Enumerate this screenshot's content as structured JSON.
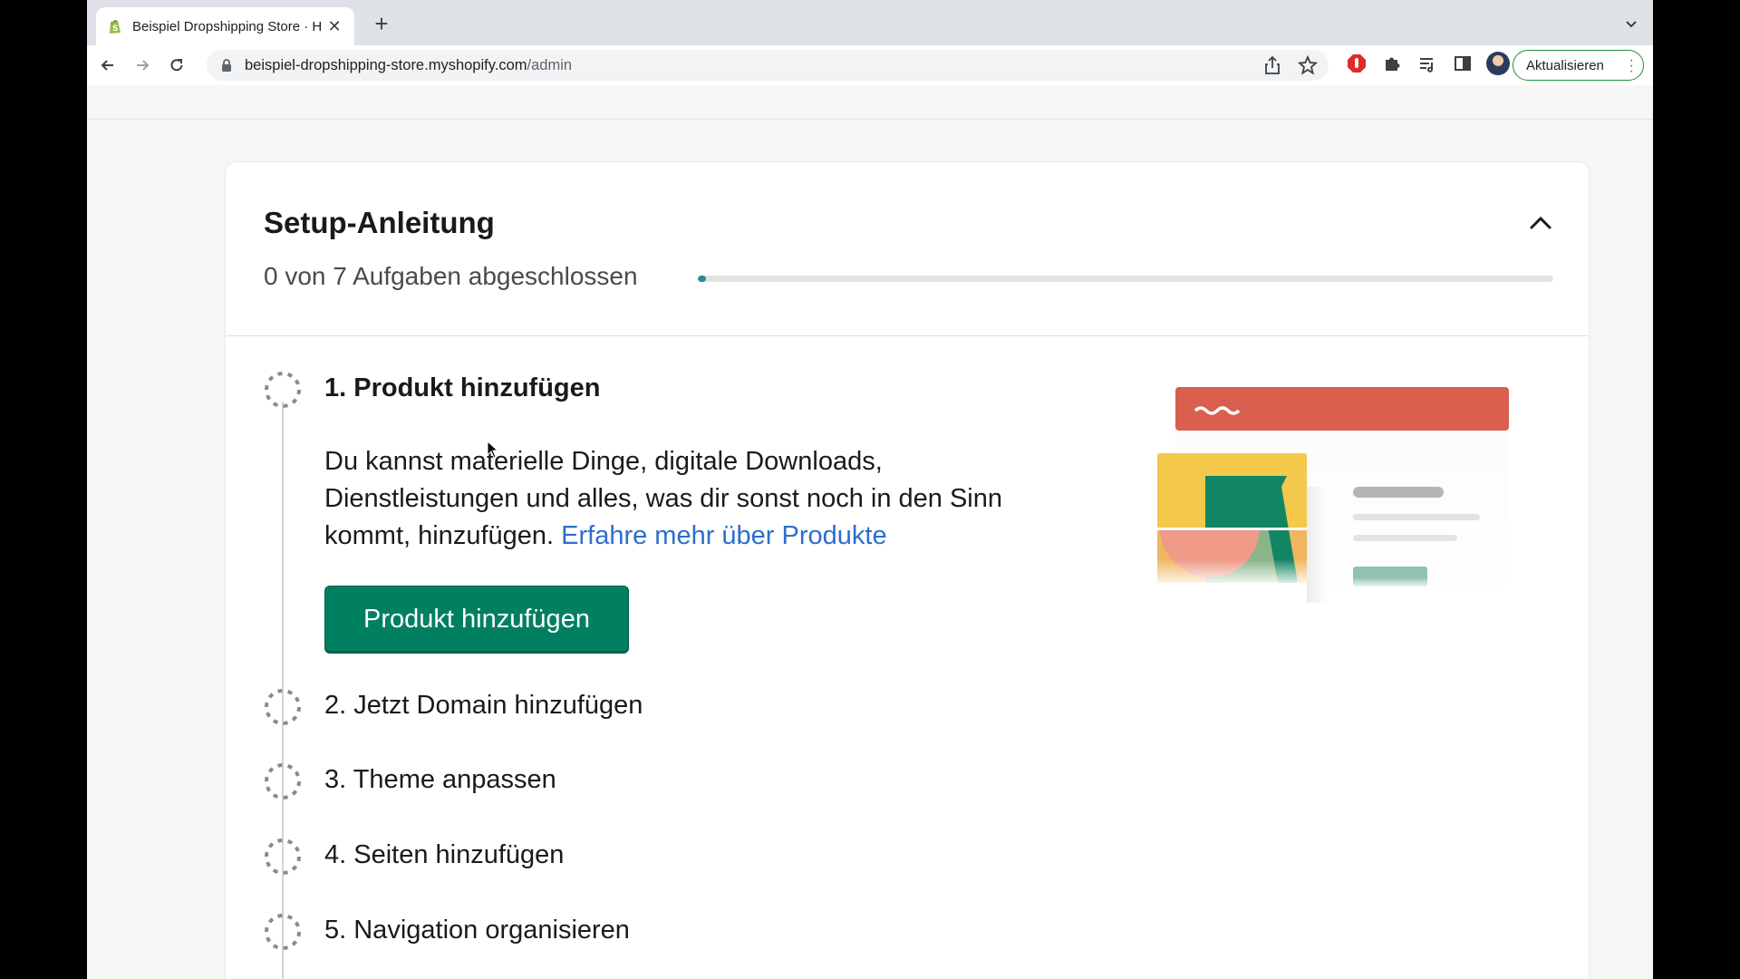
{
  "browser": {
    "tab_title": "Beispiel Dropshipping Store · H",
    "url_host": "beispiel-dropshipping-store.myshopify.com",
    "url_path": "/admin",
    "update_label": "Aktualisieren"
  },
  "setup": {
    "title": "Setup-Anleitung",
    "progress_text": "0 von 7 Aufgaben abgeschlossen",
    "progress_fraction": 0.01,
    "tasks": [
      {
        "label": "1. Produkt hinzufügen",
        "description": "Du kannst materielle Dinge, digitale Downloads, Dienstleistungen und alles, was dir sonst noch in den Sinn kommt, hinzufügen.",
        "link_text": "Erfahre mehr über Produkte",
        "button_label": "Produkt hinzufügen"
      },
      {
        "label": "2. Jetzt Domain hinzufügen"
      },
      {
        "label": "3. Theme anpassen"
      },
      {
        "label": "4. Seiten hinzufügen"
      },
      {
        "label": "5. Navigation organisieren"
      }
    ]
  },
  "colors": {
    "primary_button": "#008060",
    "link": "#2c6ecb",
    "progress": "#2a8a9a",
    "illustration_header": "#d95f4e"
  }
}
